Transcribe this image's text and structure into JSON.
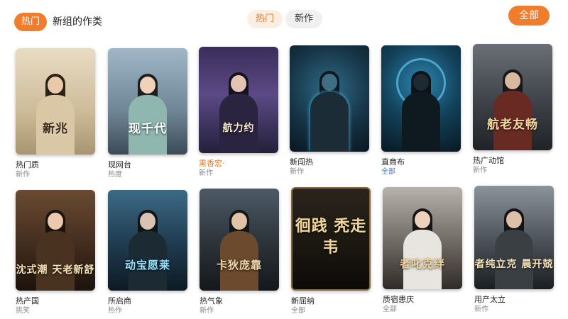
{
  "header": {
    "active_pill": "热门",
    "title": "新组的作类",
    "tabs": [
      {
        "label": "热门",
        "selected": true
      },
      {
        "label": "新作",
        "selected": false
      }
    ],
    "all_button": "全部"
  },
  "colors": {
    "accent": "#ef7d2c",
    "tab_active_bg": "#fbeee2"
  },
  "cards": [
    {
      "cover_text": "新兆",
      "title": "热门质",
      "sub": "新作"
    },
    {
      "cover_text": "现千代",
      "title": "现网台",
      "sub": "热度"
    },
    {
      "cover_text": "航力约",
      "title_prefix": "",
      "title_accent": "熏香宏·",
      "title": "",
      "sub": "新作"
    },
    {
      "cover_text": "",
      "title": "新闯热",
      "sub": "新作"
    },
    {
      "cover_text": "",
      "title": "直商布",
      "sub": "全部",
      "sub_blue": true
    },
    {
      "cover_text": "航老友畅",
      "title": "热广动馆",
      "sub": "新作"
    },
    {
      "cover_text": "沈式潮 天老新舒",
      "title": "热产国",
      "sub": "挑笑"
    },
    {
      "cover_text": "动宝愿莱",
      "title": "所启商",
      "sub": "热作"
    },
    {
      "cover_text": "卡狄庞靠",
      "title": "热气象",
      "sub": "新作"
    },
    {
      "cover_text": "徊践 秃走韦",
      "title": "新屈纳",
      "sub": "全部"
    },
    {
      "cover_text": "者叱克绊",
      "title": "质宿患庆",
      "sub": "全部"
    },
    {
      "cover_text": "者纯立克 晨开兢",
      "title": "用产太立",
      "sub": "新作"
    }
  ]
}
